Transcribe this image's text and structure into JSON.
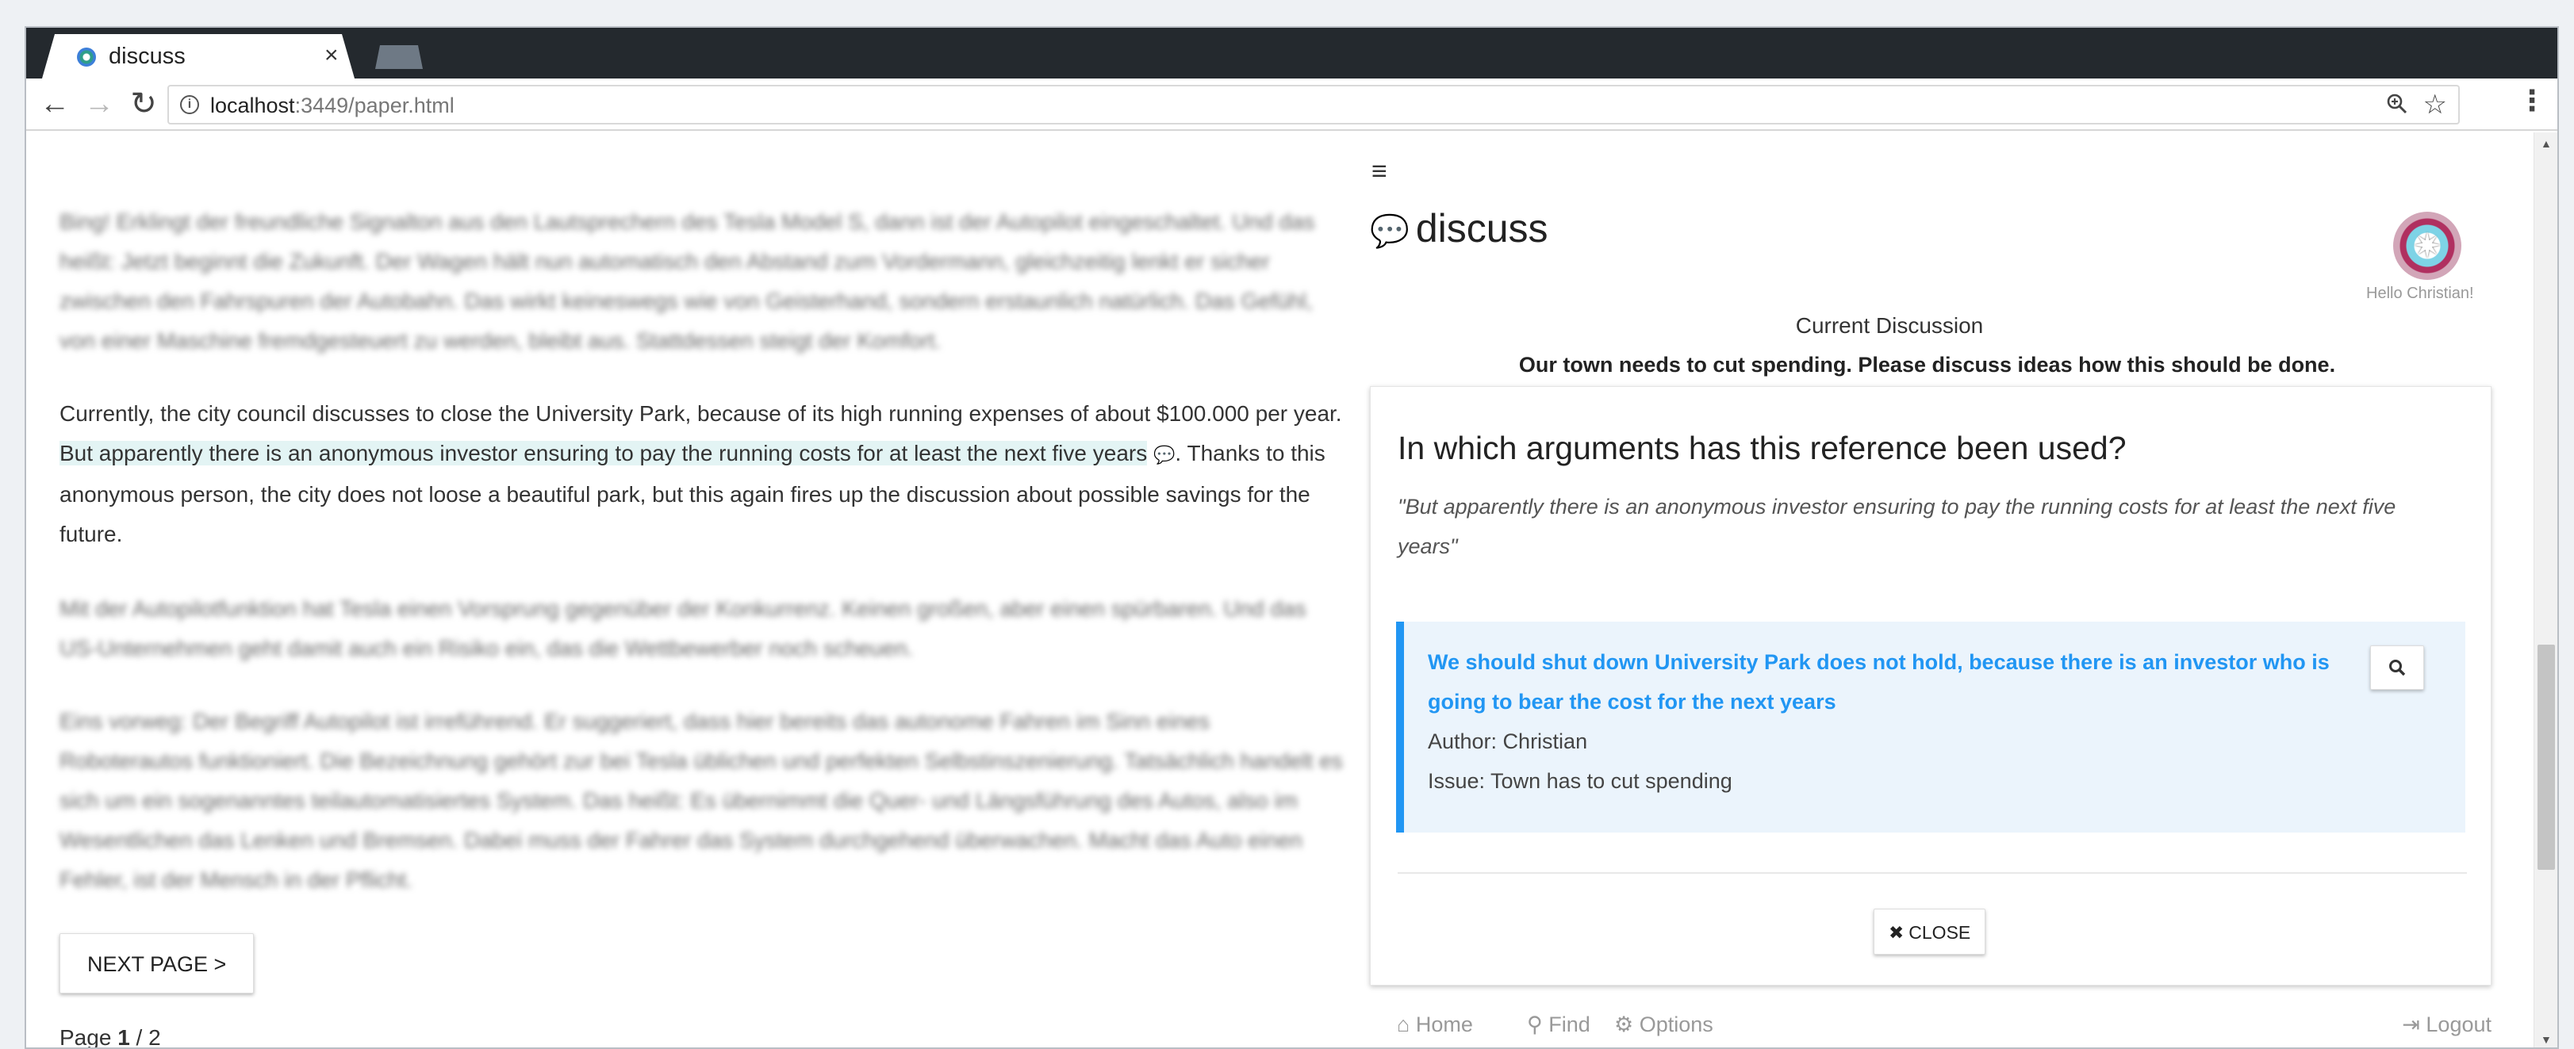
{
  "browser": {
    "tab_title": "discuss",
    "tab_close": "×",
    "url_host": "localhost",
    "url_rest": ":3449/paper.html"
  },
  "paper": {
    "blur_1": "Bing! Erklingt der freundliche Signalton aus den Lautsprechern des Tesla Model S, dann ist der Autopilot eingeschaltet. Und das heißt: Jetzt beginnt die Zukunft. Der Wagen hält nun automatisch den Abstand zum Vordermann, gleichzeitig lenkt er sicher zwischen den Fahrspuren der Autobahn. Das wirkt keineswegs wie von Geisterhand, sondern erstaunlich natürlich. Das Gefühl, von einer Maschine fremdgesteuert zu werden, bleibt aus. Stattdessen steigt der Komfort.",
    "para_before": "Currently, the city council discusses to close the University Park, because of its high running expenses of about $100.000 per year.",
    "para_highlight": "But apparently there is an anonymous investor ensuring to pay the running costs for at least the next five years",
    "para_after": ". Thanks to this anonymous person, the city does not loose a beautiful park, but this again fires up the discussion about possible savings for the future.",
    "blur_2": "Mit der Autopilotfunktion hat Tesla einen Vorsprung gegenüber der Konkurrenz. Keinen großen, aber einen spürbaren. Und das US-Unternehmen geht damit auch ein Risiko ein, das die Wettbewerber noch scheuen.",
    "blur_3": "Eins vorweg: Der Begriff Autopilot ist irreführend. Er suggeriert, dass hier bereits das autonome Fahren im Sinn eines Roboterautos funktioniert. Die Bezeichnung gehört zur bei Tesla üblichen und perfekten Selbstinszenierung. Tatsächlich handelt es sich um ein sogenanntes teilautomatisiertes System. Das heißt: Es übernimmt die Quer- und Längsführung des Autos, also im Wesentlichen das Lenken und Bremsen. Dabei muss der Fahrer das System durchgehend überwachen. Macht das Auto einen Fehler, ist der Mensch in der Pflicht.",
    "next_label": "NEXT PAGE >",
    "page_label": "Page",
    "page_current": "1",
    "page_total": " / 2"
  },
  "discuss": {
    "brand": "discuss",
    "hello": "Hello Christian!",
    "current_label": "Current Discussion",
    "issue_title": "Our town needs to cut spending. Please discuss ideas how this should be done.",
    "card_title": "In which arguments has this reference been used?",
    "quote": "\"But apparently there is an anonymous investor ensuring to pay the running costs for at least the next five years\"",
    "argument": {
      "text": "We should shut down University Park does not hold, because there is an investor who is going to bear the cost for the next years",
      "author": "Author: Christian",
      "issue": "Issue: Town has to cut spending"
    },
    "close_label": "CLOSE",
    "footer": {
      "home": "Home",
      "find": "Find",
      "options": "Options",
      "logout": "Logout"
    }
  },
  "colors": {
    "accent": "#2196f3",
    "highlight": "#e3f4f4",
    "arg_bg": "#ebf4fc"
  }
}
